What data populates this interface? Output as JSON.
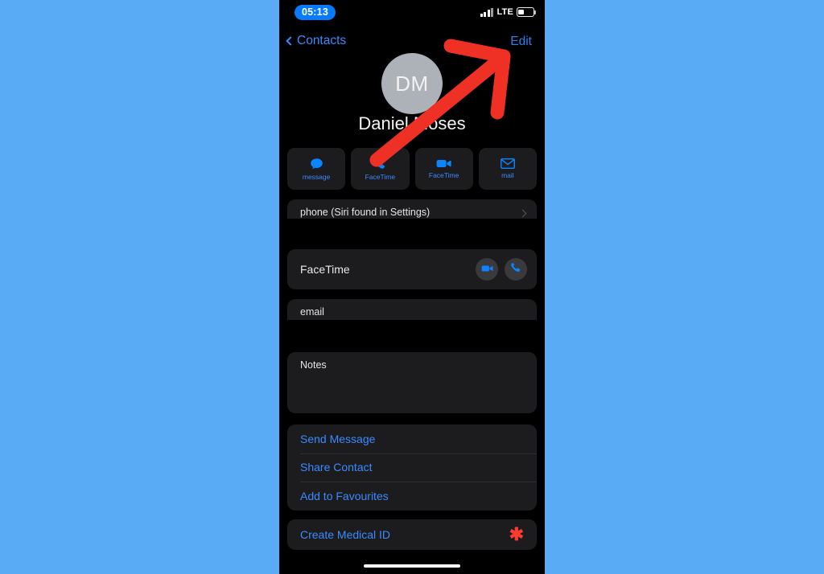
{
  "background_color": "#5aabf5",
  "status_bar": {
    "time": "05:13",
    "time_pill_color": "#067bff",
    "carrier_tech": "LTE",
    "signal_icon": "signal-bars-icon",
    "battery_icon": "battery-icon",
    "battery_level_percent": 36
  },
  "nav_bar": {
    "back_label": "Contacts",
    "back_icon": "chevron-left-icon",
    "edit_label": "Edit",
    "tint_color": "#3b8aff"
  },
  "contact": {
    "initials": "DM",
    "name": "Daniel Moses",
    "avatar_color": "#adb1b8"
  },
  "quick_actions": [
    {
      "label": "message",
      "icon": "message-bubble-icon"
    },
    {
      "label": "FaceTime",
      "icon": "phone-icon"
    },
    {
      "label": "FaceTime",
      "icon": "video-camera-icon"
    },
    {
      "label": "mail",
      "icon": "envelope-icon"
    }
  ],
  "sections": {
    "phone": {
      "label": "phone (Siri found in Settings)",
      "disclosure_icon": "chevron-right-icon",
      "value_redacted": true
    },
    "facetime": {
      "label": "FaceTime",
      "video_icon": "video-camera-icon",
      "audio_icon": "phone-icon"
    },
    "email": {
      "label": "email",
      "value_redacted": true
    },
    "notes": {
      "label": "Notes",
      "value": ""
    }
  },
  "action_list": [
    {
      "label": "Send Message"
    },
    {
      "label": "Share Contact"
    },
    {
      "label": "Add to Favourites"
    }
  ],
  "medical_id": {
    "label": "Create Medical ID",
    "icon": "medical-asterisk-icon",
    "icon_color": "#fc3b30",
    "icon_glyph": "✱"
  },
  "annotation": {
    "type": "arrow",
    "color": "#ee3124",
    "points_to": "Edit"
  },
  "home_indicator": "home-indicator"
}
